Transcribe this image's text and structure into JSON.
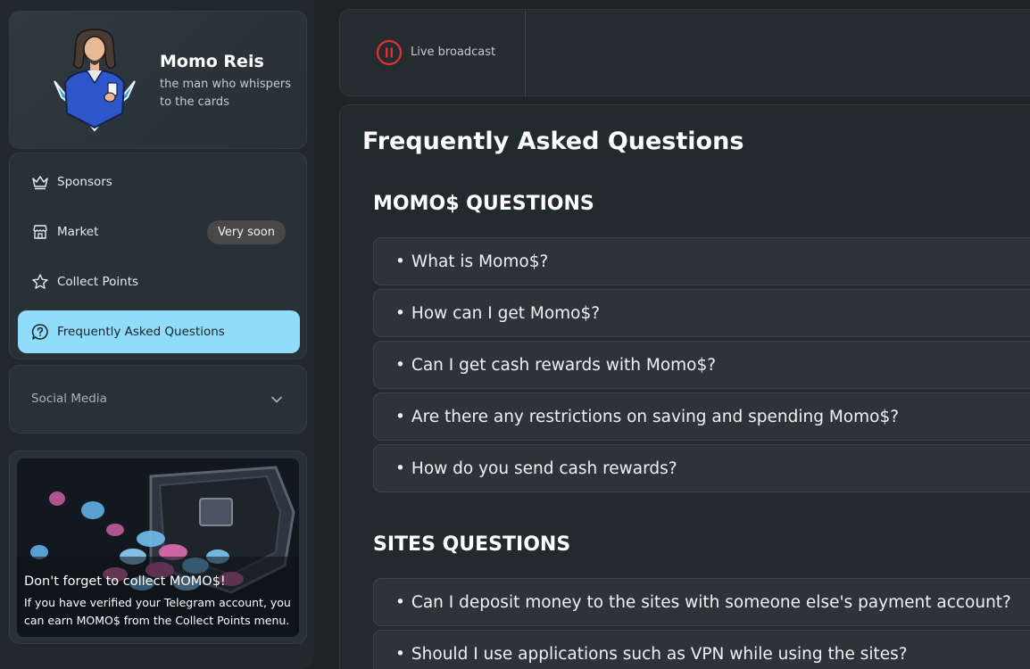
{
  "profile": {
    "name": "Momo Reis",
    "bio": "the man who whispers to the cards"
  },
  "menu": {
    "items": [
      {
        "label": "Sponsors",
        "icon": "crown-icon"
      },
      {
        "label": "Market",
        "icon": "store-icon",
        "badge": "Very soon"
      },
      {
        "label": "Collect Points",
        "icon": "star-icon"
      },
      {
        "label": "Frequently Asked Questions",
        "icon": "question-bubble-icon",
        "active": true
      }
    ]
  },
  "social": {
    "label": "Social Media",
    "icon": "chevron-down-icon"
  },
  "promo": {
    "title": "Don't forget to collect MOMO$!",
    "text": "If you have verified your Telegram account, you can earn MOMO$ from the Collect Points menu."
  },
  "topbar": {
    "live_label": "Live broadcast",
    "live_icon": "pause-circle-icon",
    "live_color": "#e0322e"
  },
  "faq": {
    "title": "Frequently Asked Questions",
    "sections": [
      {
        "title": "MOMO$ QUESTIONS",
        "questions": [
          "What is Momo$?",
          "How can I get Momo$?",
          "Can I get cash rewards with Momo$?",
          "Are there any restrictions on saving and spending Momo$?",
          "How do you send cash rewards?"
        ]
      },
      {
        "title": "SITES QUESTIONS",
        "questions": [
          "Can I deposit money to the sites with someone else's payment account?",
          "Should I use applications such as VPN while using the sites?"
        ]
      }
    ]
  },
  "colors": {
    "accent": "#8fdcfb",
    "background": "#1e2326",
    "badge": "#4a4748"
  }
}
